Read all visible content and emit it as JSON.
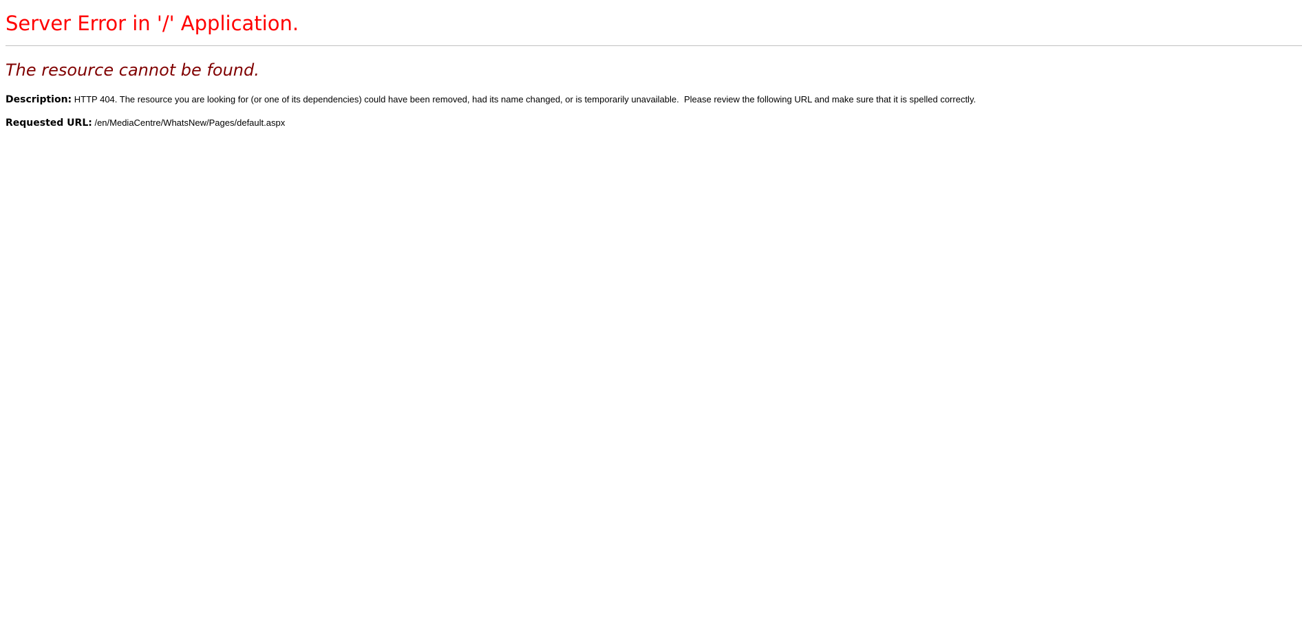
{
  "page": {
    "title": "Server Error in '/' Application.",
    "subtitle": "The resource cannot be found.",
    "description": {
      "label": "Description:",
      "text": " HTTP 404. The resource you are looking for (or one of its dependencies) could have been removed, had its name changed, or is temporarily unavailable.  Please review the following URL and make sure that it is spelled correctly."
    },
    "requested_url": {
      "label": "Requested URL:",
      "value": " /en/MediaCentre/WhatsNew/Pages/default.aspx"
    }
  },
  "colors": {
    "title": "#ff0000",
    "subtitle": "#800000",
    "divider": "#c0c0c0",
    "text": "#000000",
    "background": "#ffffff"
  }
}
